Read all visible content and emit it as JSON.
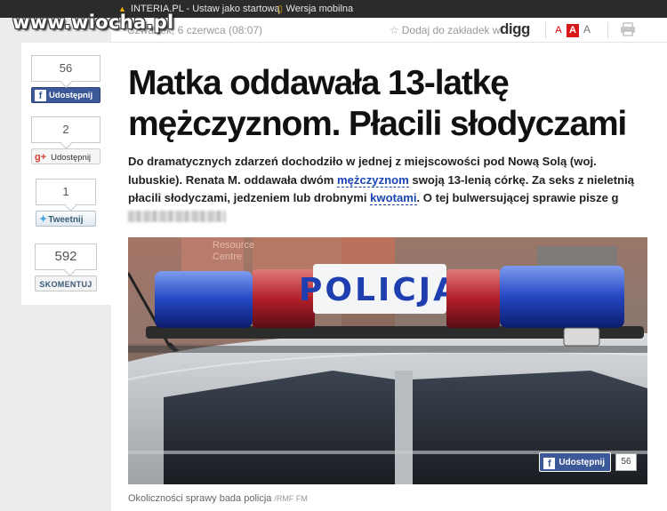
{
  "watermark": "www.wiocha.pl",
  "topbar": {
    "home_label": "INTERIA.PL - Ustaw jako startową",
    "mobile_label": "Wersja mobilna"
  },
  "meta": {
    "date": "Czwartek, 6 czerwca (08:07)",
    "bookmark_label": "Dodaj do zakładek w",
    "digg_logo": "digg",
    "font_small": "A",
    "font_mid": "A",
    "font_big": "A"
  },
  "share": {
    "facebook": {
      "count": "56",
      "label": "Udostępnij"
    },
    "google": {
      "count": "2",
      "label": "Udostępnij"
    },
    "twitter": {
      "count": "1",
      "label": "Tweetnij"
    },
    "comments": {
      "count": "592",
      "label": "SKOMENTUJ"
    }
  },
  "article": {
    "title": "Matka oddawała 13-latkę mężczyznom. Płacili słodyczami",
    "lead_1": "Do dramatycznych zdarzeń dochodziło w jednej z miejscowości pod Nową Solą (woj. lubuskie). Renata M. oddawała dwóm ",
    "lead_kw1": "mężczyznom",
    "lead_2": " swoją 13-lenią córkę. Za seks z nieletnią płacili słodyczami, jedzeniem lub drobnymi ",
    "lead_kw2": "kwotami",
    "lead_3": ". O tej bulwersującej sprawie pisze g",
    "photo_sign": "POLICJA",
    "photo_bg_text_1": "Resource",
    "photo_bg_text_2": "Centre",
    "photo_share_label": "Udostępnij",
    "photo_share_count": "56",
    "caption": "Okoliczności sprawy bada policja",
    "caption_source": "/RMF FM"
  },
  "colors": {
    "facebook": "#3b5998",
    "topbar": "#2b2b2b",
    "link": "#1a46b3",
    "font_active": "#d71919"
  }
}
